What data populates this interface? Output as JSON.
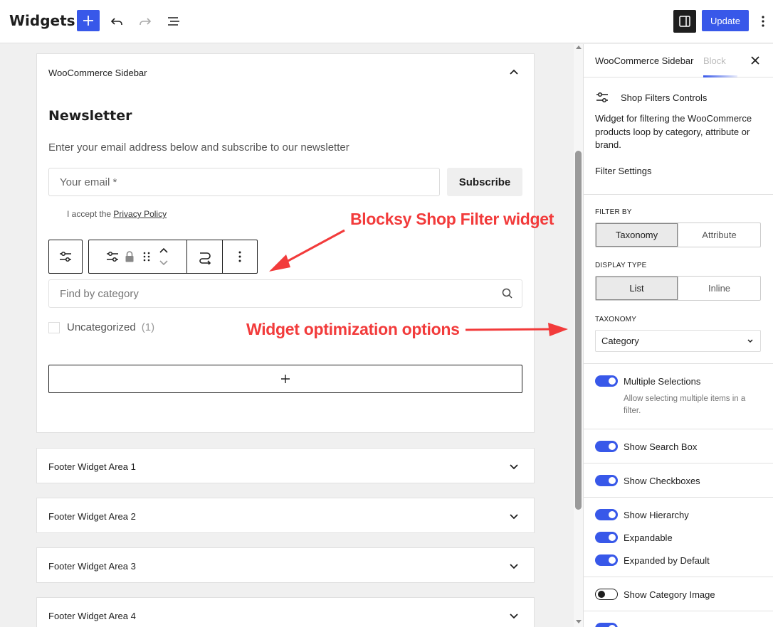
{
  "header": {
    "title": "Widgets",
    "update_label": "Update"
  },
  "canvas": {
    "sidebar_area_title": "WooCommerce Sidebar",
    "newsletter": {
      "title": "Newsletter",
      "description": "Enter your email address below and subscribe to our newsletter",
      "email_placeholder": "Your email *",
      "subscribe_label": "Subscribe",
      "privacy_prefix": "I accept the",
      "privacy_link": "Privacy Policy"
    },
    "filter": {
      "search_placeholder": "Find by category",
      "categories": [
        {
          "name": "Uncategorized",
          "count": "(1)"
        }
      ]
    },
    "footer_areas": [
      "Footer Widget Area 1",
      "Footer Widget Area 2",
      "Footer Widget Area 3",
      "Footer Widget Area 4"
    ]
  },
  "annotations": {
    "widget_label": "Blocksy Shop Filter widget",
    "options_label": "Widget optimization options",
    "color": "#f23b3b"
  },
  "sidebar": {
    "tab_area": "WooCommerce Sidebar",
    "tab_block": "Block",
    "block_title": "Shop Filters Controls",
    "block_description": "Widget for filtering the WooCommerce products loop by category, attribute or brand.",
    "filter_settings": "Filter Settings",
    "filter_by_label": "FILTER BY",
    "filter_by_options": [
      "Taxonomy",
      "Attribute"
    ],
    "display_type_label": "DISPLAY TYPE",
    "display_type_options": [
      "List",
      "Inline"
    ],
    "taxonomy_label": "TAXONOMY",
    "taxonomy_value": "Category",
    "toggles": {
      "multiple_selections": "Multiple Selections",
      "multiple_help": "Allow selecting multiple items in a filter.",
      "search_box": "Show Search Box",
      "checkboxes": "Show Checkboxes",
      "hierarchy": "Show Hierarchy",
      "expandable": "Expandable",
      "expanded_default": "Expanded by Default",
      "category_image": "Show Category Image"
    }
  },
  "colors": {
    "accent": "#3858e9",
    "annotation": "#f23b3b"
  }
}
